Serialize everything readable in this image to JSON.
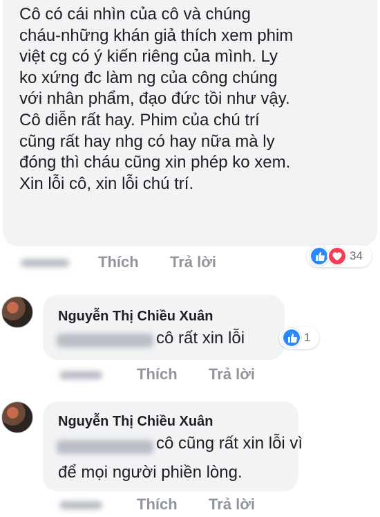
{
  "comments": [
    {
      "text_lines": [
        "Cô có cái nhìn của cô và chúng",
        "cháu-những khán giả thích xem phim",
        "việt cg có ý kiến riêng của mình.  Ly",
        "ko xứng đc làm ng của công chúng",
        "với nhân phẩm, đạo đức tồi như vậy.",
        "Cô diễn rất hay.  Phim của chú trí",
        "cũng rất hay nhg có hay nữa mà ly",
        "đóng thì cháu cũng xin phép ko xem.",
        "Xin lỗi cô, xin lỗi chú trí."
      ],
      "actions": {
        "like": "Thích",
        "reply": "Trả lời"
      },
      "reactions": {
        "count": "34",
        "icons": [
          "like-icon",
          "heart-icon"
        ],
        "colors": {
          "like": "#2d88ff",
          "heart": "#f33e58"
        }
      }
    },
    {
      "author": "Nguyễn Thị Chiều Xuân",
      "text_lines": [
        "cô rất xin lỗi"
      ],
      "actions": {
        "like": "Thích",
        "reply": "Trả lời"
      },
      "reactions": {
        "count": "1",
        "icons": [
          "like-icon"
        ]
      }
    },
    {
      "author": "Nguyễn Thị Chiều Xuân",
      "text_lines": [
        "cô cũng rất xin lỗi vì",
        "để mọi người phiền lòng."
      ],
      "actions": {
        "like": "Thích",
        "reply": "Trả lời"
      }
    }
  ]
}
